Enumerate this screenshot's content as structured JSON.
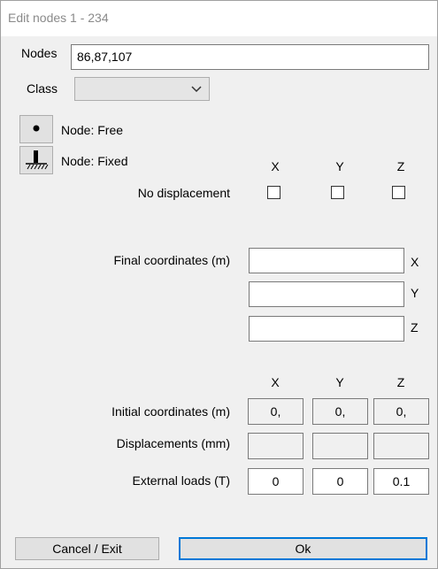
{
  "window": {
    "title": "Edit nodes 1 - 234"
  },
  "nodes": {
    "label": "Nodes",
    "value": "86,87,107"
  },
  "class": {
    "label": "Class",
    "selected": ""
  },
  "node_types": [
    {
      "label": "Node: Free",
      "icon": "free-node-icon"
    },
    {
      "label": "Node: Fixed",
      "icon": "fixed-node-icon"
    }
  ],
  "axes": {
    "x": "X",
    "y": "Y",
    "z": "Z"
  },
  "no_displacement": {
    "label": "No displacement",
    "x": false,
    "y": false,
    "z": false
  },
  "final_coordinates": {
    "label": "Final coordinates  (m)",
    "x": "",
    "y": "",
    "z": ""
  },
  "initial_coordinates": {
    "label": "Initial coordinates (m)",
    "x": "0,",
    "y": "0,",
    "z": "0,"
  },
  "displacements": {
    "label": "Displacements (mm)",
    "x": "",
    "y": "",
    "z": ""
  },
  "external_loads": {
    "label": "External loads (T)",
    "x": "0",
    "y": "0",
    "z": "0.1"
  },
  "buttons": {
    "cancel": "Cancel / Exit",
    "ok": "Ok"
  },
  "colors": {
    "accent": "#0078d7",
    "window_bg": "#f0f0f0"
  }
}
